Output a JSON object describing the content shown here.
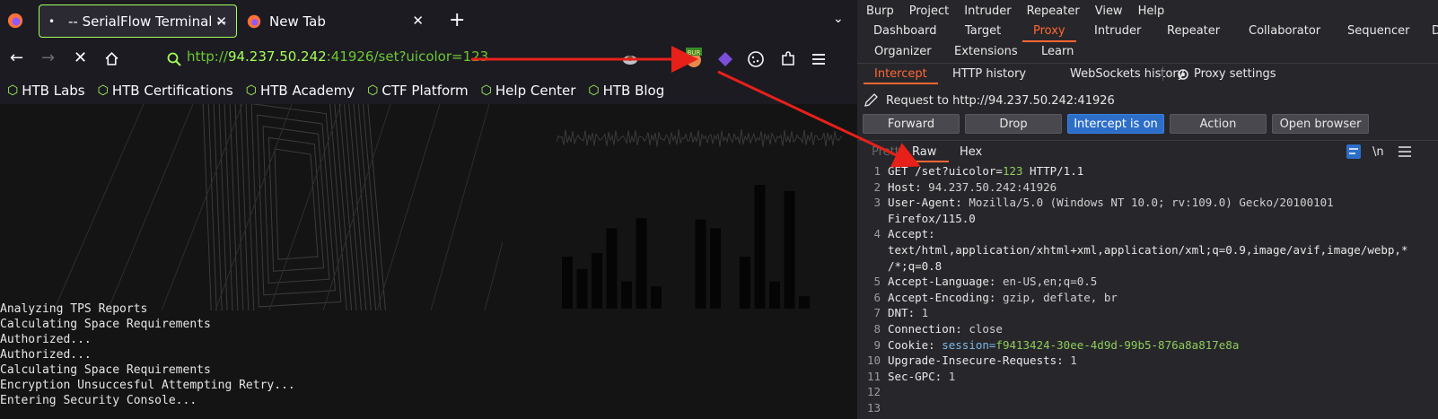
{
  "firefox": {
    "tabs": [
      {
        "title": "-- SerialFlow Terminal --",
        "indicator": "•"
      },
      {
        "title": "New Tab"
      }
    ],
    "url": {
      "scheme": "http://",
      "host": "94.237.50.242",
      "rest": ":41926/set?uicolor=123"
    },
    "bookmarks": [
      "HTB Labs",
      "HTB Certifications",
      "HTB Academy",
      "CTF Platform",
      "Help Center",
      "HTB Blog"
    ],
    "console_lines": [
      "Analyzing TPS Reports",
      "Calculating Space Requirements",
      "Authorized...",
      "Authorized...",
      "Calculating Space Requirements",
      "Encryption Unsuccesful Attempting Retry...",
      "Entering Security Console..."
    ],
    "bar_values": [
      0.42,
      0.32,
      0.45,
      0.65,
      0.22,
      0.73,
      0.18,
      0.0,
      0.0,
      0.72,
      0.65,
      0.0,
      0.42,
      1.0,
      0.22,
      0.95,
      0.1
    ],
    "colors": {
      "accent": "#a5ff5a",
      "url": "#6cc832"
    }
  },
  "burp": {
    "menu": [
      "Burp",
      "Project",
      "Intruder",
      "Repeater",
      "View",
      "Help"
    ],
    "top_tabs_row1": [
      "Dashboard",
      "Target",
      "Proxy",
      "Intruder",
      "Repeater",
      "Collaborator",
      "Sequencer",
      "D"
    ],
    "top_tabs_row2": [
      "Organizer",
      "Extensions",
      "Learn"
    ],
    "proxy_tabs": [
      "Intercept",
      "HTTP history",
      "WebSockets history"
    ],
    "proxy_settings": "Proxy settings",
    "request_to": "Request to http://94.237.50.242:41926",
    "buttons": {
      "forward": "Forward",
      "drop": "Drop",
      "intercept": "Intercept is on",
      "action": "Action",
      "open_browser": "Open browser"
    },
    "editor_tabs": {
      "pretty": "Pretty",
      "raw": "Raw",
      "hex": "Hex",
      "newline": "\\n"
    },
    "request_lines": [
      {
        "n": "1",
        "text": "GET /set?uicolor=123 HTTP/1.1"
      },
      {
        "n": "2",
        "text": "Host: 94.237.50.242:41926"
      },
      {
        "n": "3",
        "text": "User-Agent: Mozilla/5.0 (Windows NT 10.0; rv:109.0) Gecko/20100101"
      },
      {
        "n": "",
        "text": "Firefox/115.0"
      },
      {
        "n": "4",
        "text": "Accept:"
      },
      {
        "n": "",
        "text": "text/html,application/xhtml+xml,application/xml;q=0.9,image/avif,image/webp,*"
      },
      {
        "n": "",
        "text": "/*;q=0.8"
      },
      {
        "n": "5",
        "text": "Accept-Language: en-US,en;q=0.5"
      },
      {
        "n": "6",
        "text": "Accept-Encoding: gzip, deflate, br"
      },
      {
        "n": "7",
        "text": "DNT: 1"
      },
      {
        "n": "8",
        "text": "Connection: close"
      },
      {
        "n": "9",
        "text": "Cookie: session=f9413424-30ee-4d9d-99b5-876a8a817e8a"
      },
      {
        "n": "10",
        "text": "Upgrade-Insecure-Requests: 1"
      },
      {
        "n": "11",
        "text": "Sec-GPC: 1"
      },
      {
        "n": "12",
        "text": ""
      },
      {
        "n": "13",
        "text": ""
      }
    ],
    "colors": {
      "orange": "#ff6633",
      "intercept_on": "#2d6ec8"
    }
  }
}
